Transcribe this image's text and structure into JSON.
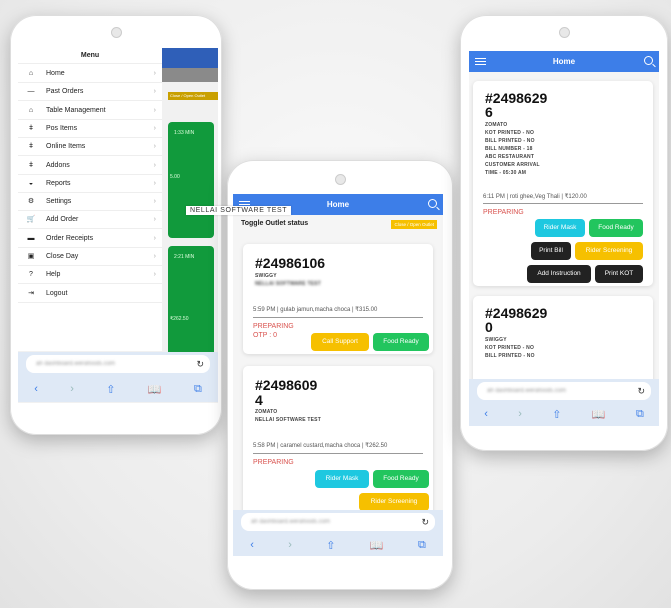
{
  "floating_label": "NELLAI SOFTWARE TEST",
  "left_phone": {
    "menu_title": "Menu",
    "items": [
      {
        "label": "Home",
        "icon": "home-icon",
        "glyph": "⌂"
      },
      {
        "label": "Past Orders",
        "icon": "dash-icon",
        "glyph": "—"
      },
      {
        "label": "Table Management",
        "icon": "home-icon",
        "glyph": "⌂"
      },
      {
        "label": "Pos Items",
        "icon": "cutlery-icon",
        "glyph": "ǂ"
      },
      {
        "label": "Online Items",
        "icon": "cutlery-icon",
        "glyph": "ǂ"
      },
      {
        "label": "Addons",
        "icon": "cutlery-icon",
        "glyph": "ǂ"
      },
      {
        "label": "Reports",
        "icon": "chart-icon",
        "glyph": "◒"
      },
      {
        "label": "Settings",
        "icon": "gear-icon",
        "glyph": "⚙"
      },
      {
        "label": "Add Order",
        "icon": "cart-icon",
        "glyph": "🛒"
      },
      {
        "label": "Order Receipts",
        "icon": "receipt-icon",
        "glyph": "▬"
      },
      {
        "label": "Close Day",
        "icon": "calendar-icon",
        "glyph": "▣"
      },
      {
        "label": "Help",
        "icon": "help-icon",
        "glyph": "?"
      },
      {
        "label": "Logout",
        "icon": "logout-icon",
        "glyph": "⇥"
      }
    ],
    "bg_outlet_btn": "Close / Open Outlet",
    "bg_timer1": "1:33 MIN",
    "bg_amount1": "5.00",
    "bg_timer2": "2:21 MIN",
    "bg_amount2": "₹262.50",
    "url": "ah  dashboard.werafoods.com"
  },
  "middle_phone": {
    "title": "Home",
    "toggle_label": "Toggle Outlet status",
    "toggle_button": "Close / Open Outlet",
    "orders": [
      {
        "id": "#24986106",
        "source": "SWIGGY",
        "outlet": "NELLAI SOFTWARE TEST",
        "meta": "5:59 PM | gulab jamun,macha choca | ₹315.00",
        "status": "PREPARING",
        "otp": "OTP : 0",
        "buttons": [
          "Call Support",
          "Food Ready"
        ]
      },
      {
        "id": "#2498609",
        "id_wrap": "4",
        "source": "ZOMATO",
        "outlet": "NELLAI SOFTWARE TEST",
        "meta": "5:58 PM | caramel custard,macha choca | ₹262.50",
        "status": "PREPARING",
        "buttons": [
          "Rider Mask",
          "Food Ready",
          "Rider Screening"
        ]
      }
    ],
    "url": "ah  dashboard.werafoods.com"
  },
  "right_phone": {
    "title": "Home",
    "orders": [
      {
        "id": "#2498629",
        "id_wrap": "6",
        "lines": [
          "ZOMATO",
          "KOT PRINTED - NO",
          "BILL PRINTED - NO",
          "BILL NUMBER - 18",
          "ABC RESTAURANT",
          "CUSTOMER ARRIVAL",
          "TIME - 05:30 AM"
        ],
        "meta": "6:11 PM | roti ghee,Veg Thali | ₹120.00",
        "status": "PREPARING",
        "buttons": [
          "Rider Mask",
          "Food Ready",
          "Print Bill",
          "Rider Screening",
          "Add Instruction",
          "Print KOT"
        ]
      },
      {
        "id": "#2498629",
        "id_wrap": "0",
        "lines": [
          "SWIGGY",
          "KOT PRINTED - NO",
          "BILL PRINTED - NO"
        ]
      }
    ],
    "url": "ah  dashboard.werafoods.com"
  },
  "toolbar": {
    "back": "‹",
    "forward": "›",
    "share": "⇧",
    "bookmarks": "📖",
    "tabs": "⧉",
    "reload": "↻"
  },
  "colors": {
    "header": "#3d7ee8",
    "yellow": "#f6c000",
    "green": "#22c55e",
    "cyan": "#1ec8e0",
    "dark": "#222222",
    "status": "#d9534f"
  }
}
